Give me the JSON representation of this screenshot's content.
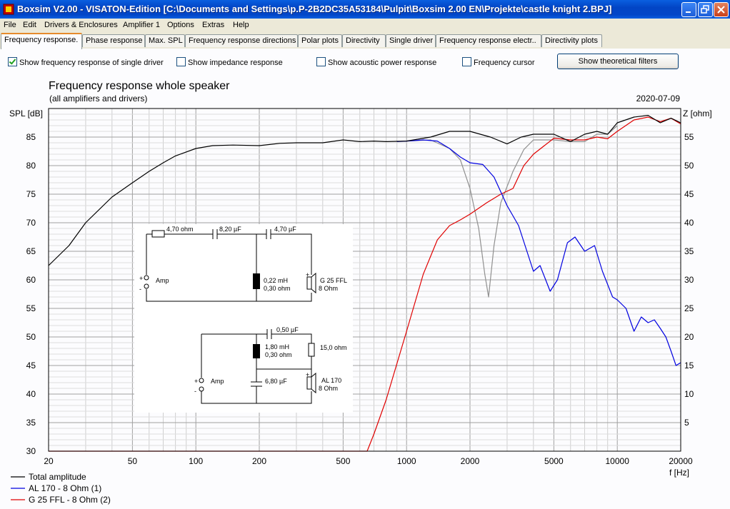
{
  "window": {
    "title": "Boxsim V2.00 - VISATON-Edition [C:\\Documents and Settings\\p.P-2B2DC35A53184\\Pulpit\\Boxsim 2.00 EN\\Projekte\\castle knight 2.BPJ]",
    "minimize_icon": "minimize-icon",
    "maximize_icon": "restore-icon",
    "close_icon": "close-icon"
  },
  "menu": [
    "File",
    "Edit",
    "Drivers & Enclosures",
    "Amplifier 1",
    "Options",
    "Extras",
    "Help"
  ],
  "tabs": [
    "Frequency response.",
    "Phase response",
    "Max. SPL",
    "Frequency response directions",
    "Polar plots",
    "Directivity",
    "Single driver",
    "Frequency response electr..",
    "Directivity plots"
  ],
  "options": {
    "single_driver": {
      "label": "Show frequency response of single driver",
      "checked": true
    },
    "impedance": {
      "label": "Show impedance response",
      "checked": false
    },
    "acoustic_power": {
      "label": "Show acoustic power response",
      "checked": false
    },
    "cursor": {
      "label": "Frequency cursor",
      "checked": false
    },
    "filters_button": "Show theoretical filters"
  },
  "chart": {
    "title": "Frequency response whole speaker",
    "subtitle": "(all amplifiers and drivers)",
    "date": "2020-07-09",
    "ylabel_left": "SPL [dB]",
    "ylabel_right": "Z [ohm]",
    "xlabel": "f [Hz]",
    "colors": {
      "total": "#000000",
      "al170": "#0000e0",
      "g25": "#e00000",
      "sum": "#909090"
    }
  },
  "chart_data": {
    "type": "line",
    "x_scale": "log",
    "xlim": [
      20,
      20000
    ],
    "ylim": [
      30,
      90
    ],
    "y2lim": [
      0,
      60
    ],
    "x_ticks": [
      20,
      50,
      100,
      200,
      500,
      1000,
      2000,
      5000,
      10000,
      20000
    ],
    "y_ticks": [
      30,
      35,
      40,
      45,
      50,
      55,
      60,
      65,
      70,
      75,
      80,
      85
    ],
    "y2_ticks": [
      5,
      10,
      15,
      20,
      25,
      30,
      35,
      40,
      45,
      50,
      55
    ],
    "legend": [
      "Total amplitude",
      "AL 170 - 8 Ohm (1)",
      "G 25 FFL - 8 Ohm (2)"
    ],
    "series": [
      {
        "name": "Total amplitude",
        "color": "#000000",
        "x": [
          20,
          25,
          30,
          40,
          50,
          60,
          70,
          80,
          100,
          120,
          150,
          200,
          250,
          300,
          400,
          500,
          600,
          700,
          800,
          1000,
          1300,
          1600,
          2000,
          2500,
          3000,
          3500,
          4000,
          5000,
          6000,
          7000,
          8000,
          9000,
          10000,
          12000,
          14000,
          16000,
          18000,
          20000
        ],
        "y": [
          62.5,
          66,
          70,
          74.5,
          77,
          79,
          80.5,
          81.7,
          83,
          83.5,
          83.6,
          83.5,
          83.9,
          84,
          84,
          84.5,
          84.2,
          84.3,
          84.2,
          84.3,
          85,
          86,
          86,
          85,
          83.8,
          85,
          85.5,
          85.5,
          84.2,
          85.5,
          86,
          85.5,
          87.5,
          88.5,
          88.8,
          87.5,
          88.3,
          87.5
        ]
      },
      {
        "name": "AL 170 - 8 Ohm (1)",
        "color": "#0000e0",
        "x": [
          900,
          1000,
          1200,
          1400,
          1600,
          1800,
          2000,
          2300,
          2600,
          3000,
          3400,
          4000,
          4300,
          4800,
          5200,
          5800,
          6300,
          7000,
          7800,
          8500,
          9500,
          10000,
          11000,
          12000,
          13000,
          14000,
          15000,
          16000,
          17000,
          18000,
          19000,
          20000
        ],
        "y": [
          84.2,
          84.3,
          84.5,
          84.3,
          83,
          81.5,
          80.5,
          80.2,
          78,
          73,
          69.5,
          61.5,
          62.5,
          58,
          60,
          66.5,
          67.5,
          65,
          66,
          61.5,
          57,
          56.5,
          55,
          51,
          53.5,
          52.5,
          53,
          51.5,
          50,
          47.5,
          45,
          45.5
        ]
      },
      {
        "name": "G 25 FFL - 8 Ohm (2)",
        "color": "#e00000",
        "x": [
          20,
          650,
          700,
          800,
          1000,
          1200,
          1400,
          1600,
          1800,
          2000,
          2400,
          2800,
          3200,
          3600,
          4000,
          5000,
          6000,
          7000,
          8000,
          9000,
          10000,
          12000,
          14000,
          16000,
          18000,
          20000
        ],
        "y": [
          30,
          30,
          33,
          39,
          51,
          61,
          67,
          69.5,
          70.5,
          71.5,
          73.5,
          75,
          76,
          80,
          82,
          84.8,
          84.5,
          84.5,
          85,
          84.7,
          86,
          88,
          88.5,
          87.7,
          88.3,
          87.3
        ]
      },
      {
        "name": "",
        "color": "#909090",
        "x": [
          1000,
          1300,
          1600,
          1800,
          2000,
          2200,
          2350,
          2450,
          2600,
          2800,
          3200,
          3600,
          4000,
          5000,
          6000,
          7000,
          8000,
          9000,
          10000
        ],
        "y": [
          84.3,
          84.5,
          83,
          81,
          76,
          69,
          61,
          57,
          66,
          73.5,
          79,
          82.8,
          84.5,
          84.5,
          84.2,
          84.2,
          85.5,
          85.5,
          87
        ]
      }
    ]
  },
  "schematic": {
    "top": {
      "r_series": "4,70 ohm",
      "c1": "8,20 µF",
      "c2": "4,70 µF",
      "l": "0,22 mH",
      "l_res": "0,30 ohm",
      "driver": "G 25 FFL",
      "driver_imp": "8 Ohm",
      "amp": "Amp"
    },
    "bottom": {
      "c": "0,50 µF",
      "l": "1,80 mH",
      "l_res": "0,30 ohm",
      "r": "15,0 ohm",
      "c_shunt": "6,80 µF",
      "driver": "AL 170",
      "driver_imp": "8 Ohm",
      "amp": "Amp"
    },
    "plus": "+",
    "minus": "-"
  }
}
